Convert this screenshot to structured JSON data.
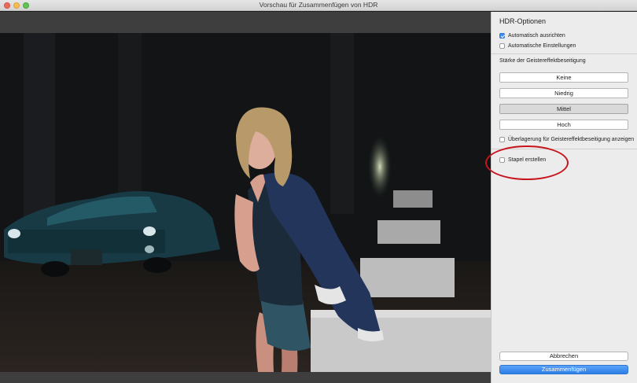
{
  "window": {
    "title": "Vorschau für Zusammenfügen von HDR"
  },
  "panel": {
    "title": "HDR-Optionen",
    "auto_align": {
      "label": "Automatisch ausrichten",
      "checked": true
    },
    "auto_settings": {
      "label": "Automatische Einstellungen",
      "checked": false
    },
    "ghost_label": "Stärke der Geistereffektbeseitigung",
    "ghost_options": [
      {
        "label": "Keine",
        "selected": false
      },
      {
        "label": "Niedrig",
        "selected": false
      },
      {
        "label": "Mittel",
        "selected": true
      },
      {
        "label": "Hoch",
        "selected": false
      }
    ],
    "overlay": {
      "label": "Überlagerung für Geistereffektbeseitigung anzeigen",
      "checked": false
    },
    "stack": {
      "label": "Stapel erstellen",
      "checked": false
    },
    "cancel_label": "Abbrechen",
    "merge_label": "Zusammenfügen"
  },
  "colors": {
    "accent": "#3b8cf0",
    "annotation": "#c8141c"
  }
}
